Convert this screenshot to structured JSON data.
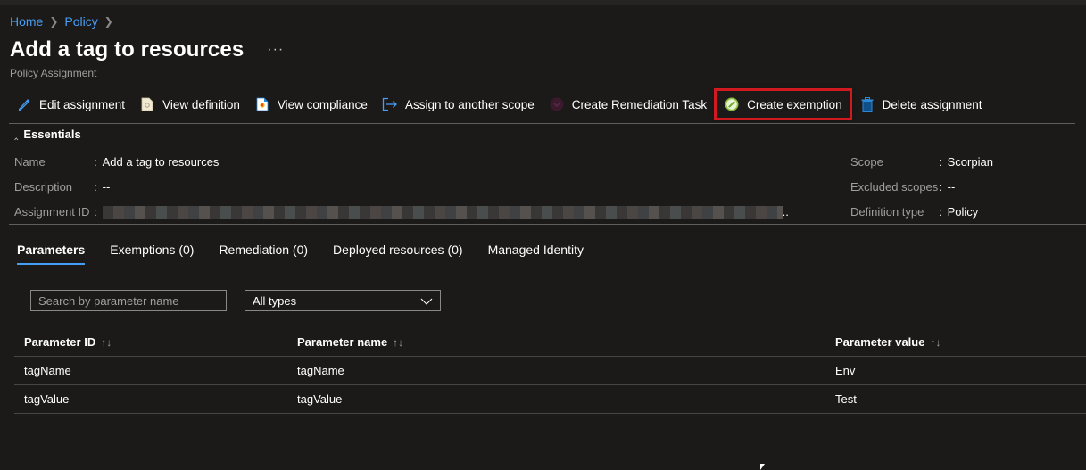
{
  "breadcrumb": [
    {
      "label": "Home"
    },
    {
      "label": "Policy"
    }
  ],
  "header": {
    "title": "Add a tag to resources",
    "more_label": "···",
    "subtitle": "Policy Assignment"
  },
  "toolbar": {
    "items": [
      {
        "label": "Edit assignment",
        "icon": "pencil-icon"
      },
      {
        "label": "View definition",
        "icon": "document-icon"
      },
      {
        "label": "View compliance",
        "icon": "compliance-report-icon"
      },
      {
        "label": "Assign to another scope",
        "icon": "sign-out-arrow-icon"
      },
      {
        "label": "Create Remediation Task",
        "icon": "remediation-icon"
      },
      {
        "label": "Create exemption",
        "icon": "exemption-icon",
        "highlighted": true
      },
      {
        "label": "Delete assignment",
        "icon": "trash-icon"
      }
    ],
    "highlight_color": "#d11a1f"
  },
  "essentials": {
    "heading": "Essentials",
    "left": [
      {
        "key": "Name",
        "value": "Add a tag to resources"
      },
      {
        "key": "Description",
        "value": "--"
      },
      {
        "key": "Assignment ID",
        "value": ".."
      }
    ],
    "right": [
      {
        "key": "Scope",
        "value": "Scorpian"
      },
      {
        "key": "Excluded scopes",
        "value": "--"
      },
      {
        "key": "Definition type",
        "value": "Policy"
      }
    ]
  },
  "tabs": [
    {
      "label": "Parameters",
      "active": true
    },
    {
      "label": "Exemptions (0)"
    },
    {
      "label": "Remediation (0)"
    },
    {
      "label": "Deployed resources (0)"
    },
    {
      "label": "Managed Identity"
    }
  ],
  "filters": {
    "search_placeholder": "Search by parameter name",
    "search_value": "",
    "type_selected": "All types"
  },
  "table": {
    "columns": [
      "Parameter ID",
      "Parameter name",
      "Parameter value"
    ],
    "sort_glyph": "↑↓",
    "rows": [
      [
        "tagName",
        "tagName",
        "Env"
      ],
      [
        "tagValue",
        "tagValue",
        "Test"
      ]
    ]
  },
  "colors": {
    "background": "#1b1a19",
    "link": "#479ef5",
    "tab_underline": "#479ef5"
  }
}
